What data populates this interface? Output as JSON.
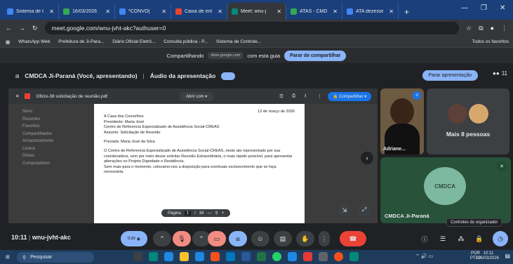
{
  "browser": {
    "tabs": [
      {
        "label": "Sistema de Con",
        "color": "#4285f4"
      },
      {
        "label": "16/03/2026",
        "color": "#34a853"
      },
      {
        "label": "*CONVO(",
        "color": "#4285f4"
      },
      {
        "label": "Caixa de entrad",
        "color": "#ea4335"
      },
      {
        "label": "Meet: wnu-j",
        "color": "#00897b",
        "active": true
      },
      {
        "label": "ATAS - CMDCA",
        "color": "#34a853"
      },
      {
        "label": "ATA dezesseis d",
        "color": "#4285f4"
      }
    ],
    "url": "meet.google.com/wnu-jvht-akc?authuser=0",
    "bookmarks": [
      "WhatsApp Web",
      "Prefeitura de Ji-Para...",
      "Diário Oficial Eletrô...",
      "Consulta pública - P...",
      "Sistema de Controle..."
    ],
    "all_bookmarks": "Todos os favoritos"
  },
  "share_bar": {
    "prefix": "Compartilhando",
    "domain": "drive.google.com",
    "suffix": "com esta guia",
    "button": "Parar de compartilhar"
  },
  "meet": {
    "presenter": "CMDCA Ji-Paraná (Você, apresentando)",
    "audio": "Áudio da apresentação",
    "stop": "Parar apresentação",
    "people_count": "11",
    "meeting_code": "wnu-jvht-akc",
    "time": "10:11",
    "more_people": "Mais 8 pessoas",
    "tile_names": {
      "first": "Adriane...",
      "host": "CMDCA Ji-Paraná",
      "logo": "CMDCA"
    },
    "tooltip": "Controles do organizador",
    "badge": "tl;dv"
  },
  "pdf": {
    "filename": "Oficio-38 solicitação de reunião.pdf",
    "open_with": "Abrir com",
    "share": "Compartilhar",
    "page_label": "Página",
    "page_current": "1",
    "page_total": "34",
    "date": "12 de março de 2026",
    "to": "A Casa dos Conselhos",
    "president": "Presidente: Maria José",
    "center": "Centro de Referencia Especializado de Assistência Social-CREAS",
    "subject": "Assunto: Solicitação de Reunião",
    "greeting": "Prezada: Maria José da Silva",
    "body1": "O Centro de Referencia Especializado de Assistência Social-CREAS, neste ato representado por sua coordenadora, vem por meio desse solicitar Reunião Extraordinária, o mais rápido possível, para apresentar alterações no Projeto Dignidade e Residência.",
    "body2": "Sem mais para o momento, colocamo-nos a disposição para eventuais esclarecimento que se faça necessária.",
    "side": [
      "Novo",
      "Recentes",
      "Favoritos",
      "Compartilhados",
      "Armazenamento",
      "Lixeira",
      "Drives",
      "Computadores"
    ]
  },
  "taskbar": {
    "search": "Pesquisar",
    "lang": "POR",
    "layout": "PTB2",
    "clock_time": "10:11",
    "clock_date": "16/03/2026"
  }
}
